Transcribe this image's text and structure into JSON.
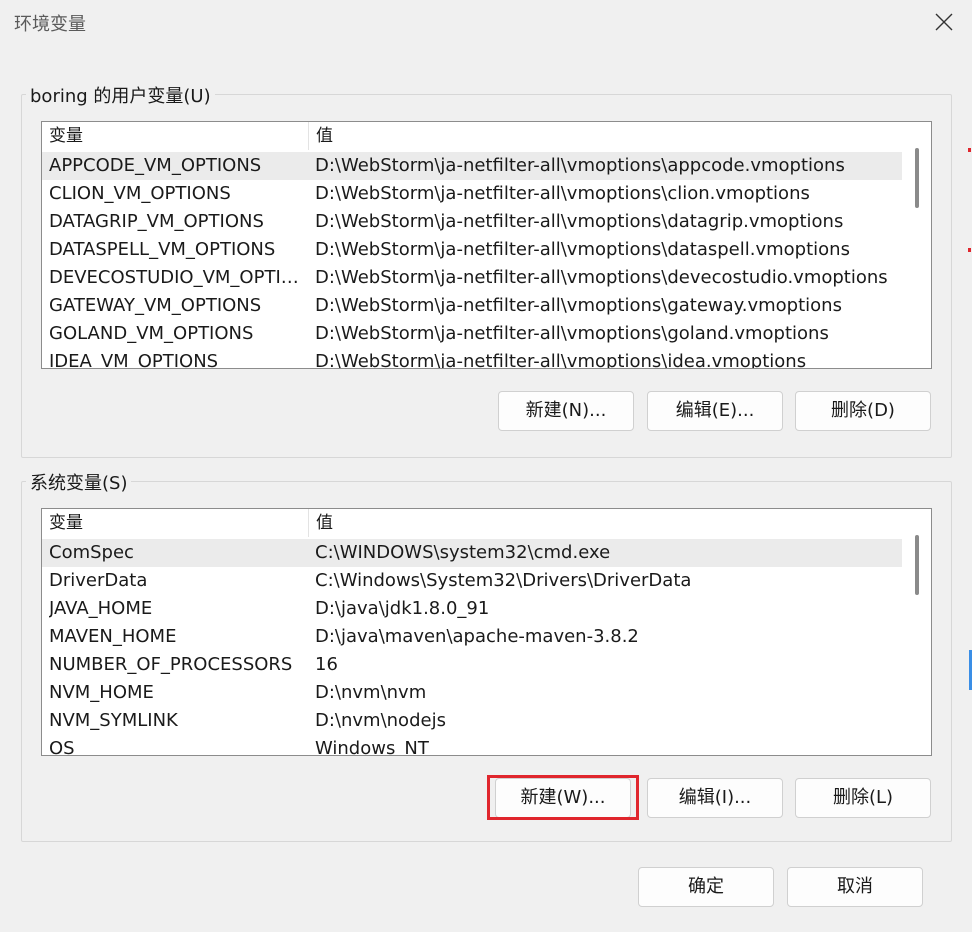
{
  "window": {
    "title": "环境变量",
    "close_icon": "close-icon"
  },
  "user_vars": {
    "group_label": "boring 的用户变量(U)",
    "columns": {
      "name": "变量",
      "value": "值"
    },
    "rows": [
      {
        "name": "APPCODE_VM_OPTIONS",
        "value": "D:\\WebStorm\\ja-netfilter-all\\vmoptions\\appcode.vmoptions"
      },
      {
        "name": "CLION_VM_OPTIONS",
        "value": "D:\\WebStorm\\ja-netfilter-all\\vmoptions\\clion.vmoptions"
      },
      {
        "name": "DATAGRIP_VM_OPTIONS",
        "value": "D:\\WebStorm\\ja-netfilter-all\\vmoptions\\datagrip.vmoptions"
      },
      {
        "name": "DATASPELL_VM_OPTIONS",
        "value": "D:\\WebStorm\\ja-netfilter-all\\vmoptions\\dataspell.vmoptions"
      },
      {
        "name": "DEVECOSTUDIO_VM_OPTIO...",
        "value": "D:\\WebStorm\\ja-netfilter-all\\vmoptions\\devecostudio.vmoptions"
      },
      {
        "name": "GATEWAY_VM_OPTIONS",
        "value": "D:\\WebStorm\\ja-netfilter-all\\vmoptions\\gateway.vmoptions"
      },
      {
        "name": "GOLAND_VM_OPTIONS",
        "value": "D:\\WebStorm\\ja-netfilter-all\\vmoptions\\goland.vmoptions"
      },
      {
        "name": "IDEA_VM_OPTIONS",
        "value": "D:\\WebStorm\\ja-netfilter-all\\vmoptions\\idea.vmoptions"
      }
    ],
    "buttons": {
      "new": "新建(N)...",
      "edit": "编辑(E)...",
      "delete": "删除(D)"
    }
  },
  "system_vars": {
    "group_label": "系统变量(S)",
    "columns": {
      "name": "变量",
      "value": "值"
    },
    "rows": [
      {
        "name": "ComSpec",
        "value": "C:\\WINDOWS\\system32\\cmd.exe"
      },
      {
        "name": "DriverData",
        "value": "C:\\Windows\\System32\\Drivers\\DriverData"
      },
      {
        "name": "JAVA_HOME",
        "value": "D:\\java\\jdk1.8.0_91"
      },
      {
        "name": "MAVEN_HOME",
        "value": "D:\\java\\maven\\apache-maven-3.8.2"
      },
      {
        "name": "NUMBER_OF_PROCESSORS",
        "value": "16"
      },
      {
        "name": "NVM_HOME",
        "value": "D:\\nvm\\nvm"
      },
      {
        "name": "NVM_SYMLINK",
        "value": "D:\\nvm\\nodejs"
      },
      {
        "name": "OS",
        "value": "Windows_NT"
      }
    ],
    "buttons": {
      "new": "新建(W)...",
      "edit": "编辑(I)...",
      "delete": "删除(L)"
    }
  },
  "footer": {
    "ok": "确定",
    "cancel": "取消"
  },
  "colors": {
    "highlight_border": "#e0262d",
    "selected_row": "#ebebeb"
  }
}
